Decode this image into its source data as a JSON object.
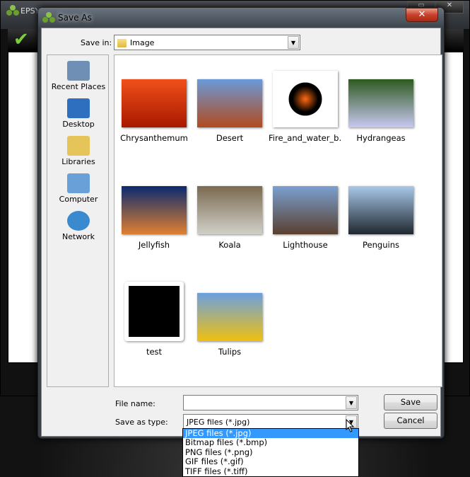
{
  "app": {
    "title": "EPSYS..."
  },
  "dialog": {
    "title": "Save As",
    "close_icon": "close-icon"
  },
  "save_in": {
    "label": "Save in:",
    "value": "Image"
  },
  "places": [
    {
      "label": "Recent Places",
      "color": "#6f8fb5"
    },
    {
      "label": "Desktop",
      "color": "#2f6fc0"
    },
    {
      "label": "Libraries",
      "color": "#e5c45a"
    },
    {
      "label": "Computer",
      "color": "#6aa0d8"
    },
    {
      "label": "Network",
      "color": "#3a8ad0"
    }
  ],
  "files": [
    {
      "name": "Chrysanthemum",
      "colors": [
        "#f0501a",
        "#a81800"
      ]
    },
    {
      "name": "Desert",
      "colors": [
        "#6a9ad8",
        "#b24a1e"
      ]
    },
    {
      "name": "Fire_and_water_b...",
      "colors": [
        "#ffffff",
        "#ff6a10"
      ]
    },
    {
      "name": "Hydrangeas",
      "colors": [
        "#2e5a20",
        "#c8c8f0"
      ]
    },
    {
      "name": "Jellyfish",
      "colors": [
        "#0a2a70",
        "#e08030"
      ]
    },
    {
      "name": "Koala",
      "colors": [
        "#7a6a50",
        "#d0d0c8"
      ]
    },
    {
      "name": "Lighthouse",
      "colors": [
        "#7aa0d0",
        "#5a4030"
      ]
    },
    {
      "name": "Penguins",
      "colors": [
        "#a8c8e8",
        "#202830"
      ]
    },
    {
      "name": "test",
      "colors": [
        "#ffffff",
        "#000000"
      ]
    },
    {
      "name": "Tulips",
      "colors": [
        "#6aa0e0",
        "#f0c010"
      ]
    }
  ],
  "file_name": {
    "label": "File name:",
    "value": ""
  },
  "save_as_type": {
    "label": "Save as type:",
    "value": "JPEG files (*.jpg)",
    "options": [
      "JPEG files (*.jpg)",
      "Bitmap files (*.bmp)",
      "PNG files (*.png)",
      "GIF files (*.gif)",
      "TIFF files (*.tiff)"
    ]
  },
  "buttons": {
    "save": "Save",
    "cancel": "Cancel"
  }
}
